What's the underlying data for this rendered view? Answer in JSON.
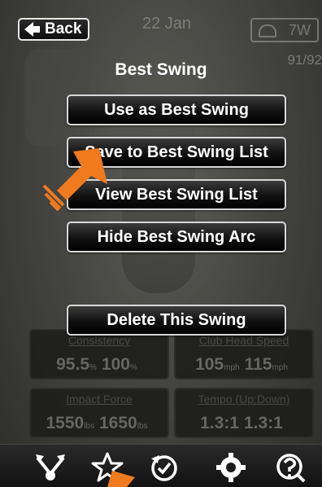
{
  "header": {
    "back_label": "Back",
    "date": "22 Jan",
    "club": "7W",
    "swing_counter": "91/92"
  },
  "menu": {
    "title": "Best Swing",
    "items": [
      {
        "label": "Use as Best Swing"
      },
      {
        "label": "Save to Best Swing List"
      },
      {
        "label": "View Best Swing List"
      },
      {
        "label": "Hide Best Swing Arc"
      },
      {
        "label": "Delete This Swing"
      }
    ]
  },
  "stats": [
    {
      "label": "Consistency",
      "value1": "95.5",
      "unit1": "%",
      "value2": "100",
      "unit2": "%"
    },
    {
      "label": "Club Head Speed",
      "value1": "105",
      "unit1": "mph",
      "value2": "115",
      "unit2": "mph"
    },
    {
      "label": "Impact Force",
      "value1": "1550",
      "unit1": "lbs",
      "value2": "1650",
      "unit2": "lbs"
    },
    {
      "label": "Tempo (Up:Down)",
      "value1": "1.3:1",
      "unit1": "",
      "value2": "1.3:1",
      "unit2": ""
    }
  ],
  "tabs": [
    {
      "icon": "swing-compare-icon"
    },
    {
      "icon": "star-icon"
    },
    {
      "icon": "history-icon"
    },
    {
      "icon": "gear-icon"
    },
    {
      "icon": "help-icon"
    }
  ],
  "colors": {
    "accent_pointer": "#f07a1e",
    "button_border": "#d8d8d8",
    "button_bg": "#111111"
  }
}
